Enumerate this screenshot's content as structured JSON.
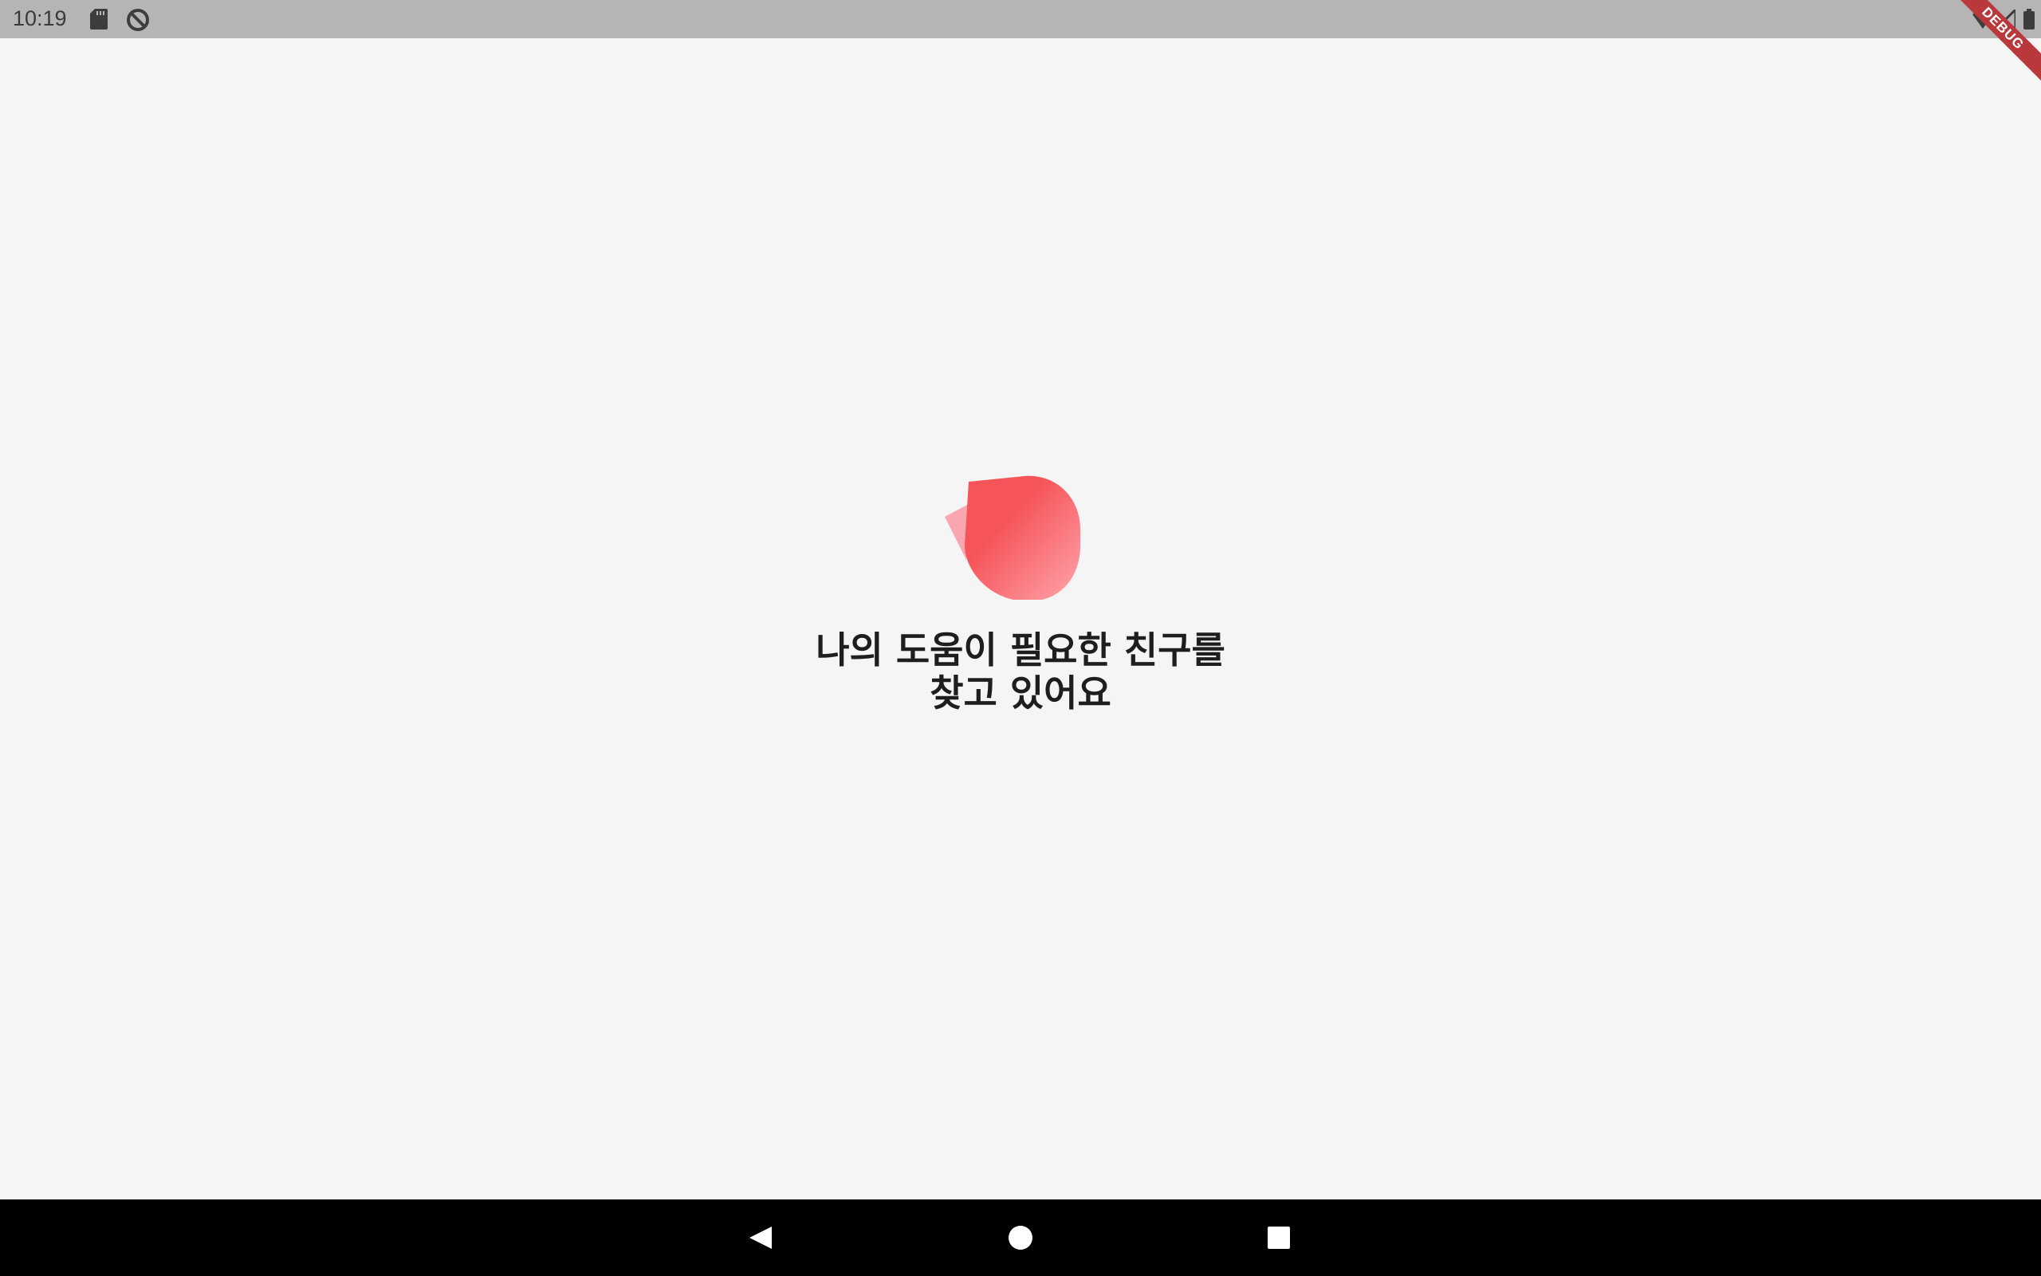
{
  "status_bar": {
    "time": "10:19",
    "icons": [
      "sd-card-icon",
      "sync-disabled-icon",
      "wifi-icon",
      "signal-icon",
      "battery-icon"
    ]
  },
  "debug_banner": {
    "label": "DEBUG",
    "color": "#b9383c"
  },
  "main": {
    "logo_icon": "heart-petal-logo-icon",
    "message_line1": "나의 도움이 필요한 친구를",
    "message_line2": "찾고 있어요",
    "accent_colors": [
      "#f55458",
      "#ff9aa4",
      "#f9a6b0"
    ]
  },
  "nav_bar": {
    "buttons": [
      "back-icon",
      "home-icon",
      "recents-icon"
    ]
  }
}
